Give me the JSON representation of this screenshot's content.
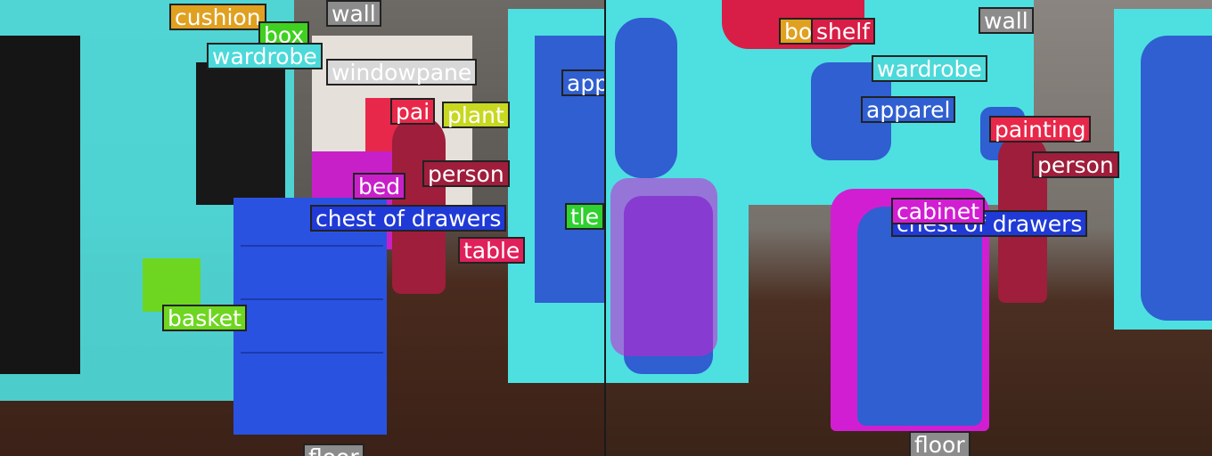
{
  "colors": {
    "wall": "#8c8c8c",
    "wardrobe": "#4cd9d9",
    "apparel": "#2f5fd0",
    "chest": "#1f3ad6",
    "cabinet": "#d21ed2",
    "person": "#9e1e3c",
    "table": "#e0205a",
    "painting": "#e8284a",
    "shelf": "#d81e46",
    "basket": "#6ed620",
    "plant": "#c8d820",
    "cushion": "#e0a020",
    "bed": "#c820c8",
    "windowpane": "#d8d8d8",
    "box": "#40d020",
    "floor": "#8c8c8c",
    "bottle": "#30d030"
  },
  "left_labels": {
    "cushion": "cushion",
    "box": "box",
    "wall": "wall",
    "wardrobe": "wardrobe",
    "windowpane": "windowpane",
    "apparel": "app",
    "painting": "pai",
    "plant": "plant",
    "person": "person",
    "bed": "bed",
    "chest": "chest of drawers",
    "bottle": "tle",
    "table": "table",
    "basket": "basket",
    "floor": "floor"
  },
  "right_labels": {
    "box": "bo",
    "shelf": "shelf",
    "wall": "wall",
    "wardrobe": "wardrobe",
    "apparel": "apparel",
    "painting": "painting",
    "person": "person",
    "cabinet": "cabinet",
    "chest": "chest of drawers",
    "floor": "floor"
  }
}
